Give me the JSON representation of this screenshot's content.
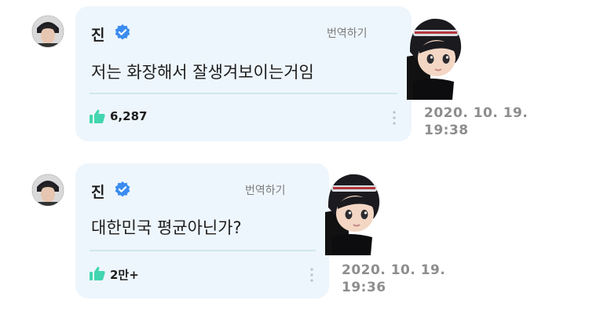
{
  "messages": [
    {
      "author": "진",
      "translate_label": "번역하기",
      "text": "저는 화장해서 잘생겨보이는거임",
      "likes": "6,287",
      "date": "2020. 10. 19.",
      "time": "19:38"
    },
    {
      "author": "진",
      "translate_label": "번역하기",
      "text": "대한민국 평균아닌가?",
      "likes": "2만+",
      "date": "2020. 10. 19.",
      "time": "19:36"
    }
  ],
  "icons": {
    "verified": "verified-badge-icon",
    "like": "thumbs-up-icon",
    "more": "more-vertical-icon",
    "sticker": "character-sticker"
  },
  "colors": {
    "bubble": "#eef6fd",
    "verified": "#3b8cf0",
    "like": "#42d6b0",
    "timestamp": "#8d8d8d"
  }
}
